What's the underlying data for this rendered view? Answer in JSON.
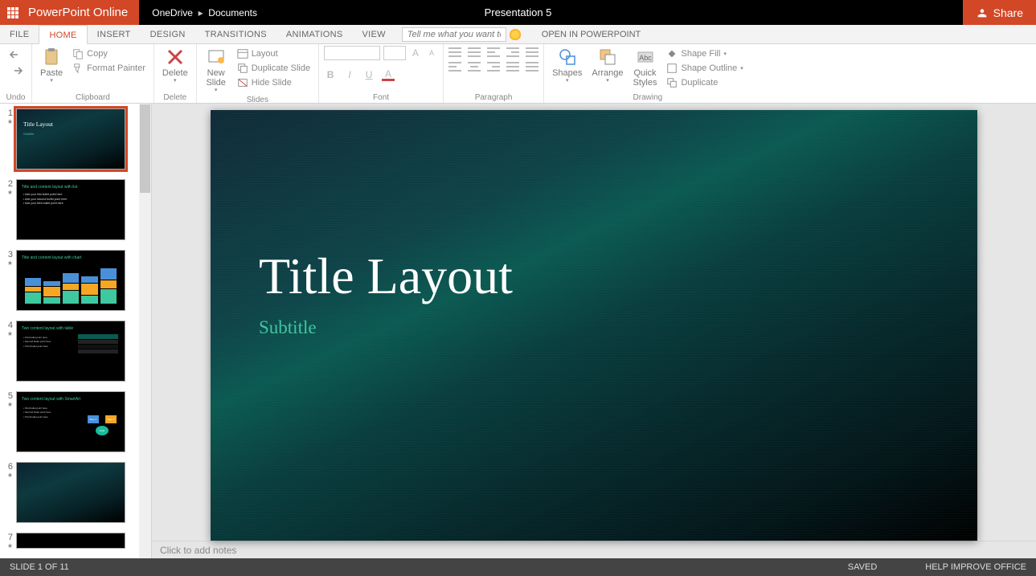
{
  "app": {
    "name": "PowerPoint Online"
  },
  "breadcrumb": {
    "root": "OneDrive",
    "folder": "Documents"
  },
  "presentation": {
    "title": "Presentation 5"
  },
  "share": {
    "label": "Share"
  },
  "menu": {
    "file": "FILE",
    "home": "HOME",
    "insert": "INSERT",
    "design": "DESIGN",
    "transitions": "TRANSITIONS",
    "animations": "ANIMATIONS",
    "view": "VIEW",
    "tellme_placeholder": "Tell me what you want to do",
    "open_in": "OPEN IN POWERPOINT"
  },
  "ribbon": {
    "undo": {
      "label": "Undo"
    },
    "clipboard": {
      "group": "Clipboard",
      "paste": "Paste",
      "copy": "Copy",
      "format_painter": "Format Painter"
    },
    "delete": {
      "group": "Delete",
      "label": "Delete"
    },
    "slides": {
      "group": "Slides",
      "new_slide": "New\nSlide",
      "layout": "Layout",
      "duplicate": "Duplicate Slide",
      "hide": "Hide Slide"
    },
    "font": {
      "group": "Font"
    },
    "paragraph": {
      "group": "Paragraph"
    },
    "drawing": {
      "group": "Drawing",
      "shapes": "Shapes",
      "arrange": "Arrange",
      "quick_styles": "Quick\nStyles",
      "shape_fill": "Shape Fill",
      "shape_outline": "Shape Outline",
      "duplicate": "Duplicate"
    }
  },
  "slide": {
    "title": "Title Layout",
    "subtitle": "Subtitle"
  },
  "thumbs": {
    "s1": {
      "num": "1",
      "title": "Title Layout",
      "sub": "Subtitle"
    },
    "s2": {
      "num": "2",
      "title": "Title and content layout with list",
      "b1": "• Add your first bullet point here",
      "b2": "• Add your second bullet point here",
      "b3": "• Add your third bullet point here"
    },
    "s3": {
      "num": "3",
      "title": "Title and content layout with chart"
    },
    "s4": {
      "num": "4",
      "title": "Two content layout with table"
    },
    "s5": {
      "num": "5",
      "title": "Two content layout with SmartArt"
    },
    "s6": {
      "num": "6"
    },
    "s7": {
      "num": "7"
    }
  },
  "notes": {
    "placeholder": "Click to add notes"
  },
  "status": {
    "slide_pos": "SLIDE 1 OF 11",
    "saved": "SAVED",
    "help": "HELP IMPROVE OFFICE"
  }
}
